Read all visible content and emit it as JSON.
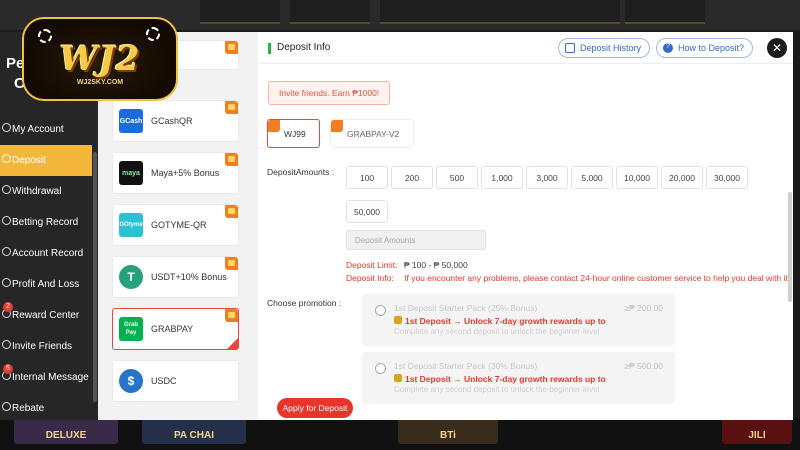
{
  "logo": {
    "text": "WJ2",
    "site": "WJ2SKY.COM"
  },
  "sidebar": {
    "title_fragment_1": "Pe",
    "title_fragment_2": "Co",
    "items": [
      {
        "label": "My Account",
        "icon": "user-icon",
        "active": false
      },
      {
        "label": "Deposit",
        "icon": "wallet-icon",
        "active": true
      },
      {
        "label": "Withdrawal",
        "icon": "withdraw-icon",
        "active": false
      },
      {
        "label": "Betting Record",
        "icon": "record-icon",
        "active": false
      },
      {
        "label": "Account Record",
        "icon": "list-icon",
        "active": false
      },
      {
        "label": "Profit And Loss",
        "icon": "chart-icon",
        "active": false
      },
      {
        "label": "Reward Center",
        "icon": "gift-icon",
        "active": false,
        "badge": "2"
      },
      {
        "label": "Invite Friends",
        "icon": "friends-icon",
        "active": false
      },
      {
        "label": "Internal Message",
        "icon": "message-icon",
        "active": false,
        "badge": "5"
      },
      {
        "label": "Rebate",
        "icon": "rebate-icon",
        "active": false
      }
    ]
  },
  "channels": [
    {
      "label": "",
      "logo_text": "",
      "logo_color": "#ffffff",
      "selected": false
    },
    {
      "label": "GCashQR",
      "logo_text": "GCash",
      "logo_color": "#1a6be0",
      "selected": false
    },
    {
      "label": "Maya+5% Bonus",
      "logo_text": "maya",
      "logo_color": "#111111",
      "selected": false
    },
    {
      "label": "GOTYME-QR",
      "logo_text": "GOtyme",
      "logo_color": "#29c2d3",
      "selected": false
    },
    {
      "label": "USDT+10% Bonus",
      "logo_text": "T",
      "logo_color": "#26a17b",
      "selected": false
    },
    {
      "label": "GRABPAY",
      "logo_text": "Grab Pay",
      "logo_color": "#00b14f",
      "selected": true
    },
    {
      "label": "USDC",
      "logo_text": "$",
      "logo_color": "#2775ca",
      "selected": false
    }
  ],
  "panel": {
    "title": "Deposit Info",
    "history_label": "Deposit History",
    "howto_label": "How to Deposit?",
    "close_glyph": "✕",
    "invite_text": "Invite friends. Earn ₱1000!",
    "sub_channels": [
      {
        "label": "WJ99",
        "selected": true
      },
      {
        "label": "GRABPAY-V2",
        "selected": false
      }
    ],
    "amounts_label": "DepositAmounts :",
    "amounts": [
      "100",
      "200",
      "500",
      "1,000",
      "3,000",
      "5,000",
      "10,000",
      "20,000",
      "30,000",
      "50,000"
    ],
    "amount_placeholder": "Deposit Amounts",
    "limit_label": "Deposit Limit:",
    "limit_value": "₱ 100 - ₱ 50,000",
    "info_label": "Deposit Info:",
    "info_text": "If you encounter any problems, please contact 24-hour online customer service to help you deal with it",
    "promotion_label": "Choose promotion :",
    "promotions": [
      {
        "title": "1st Deposit Starter Pack (25% Bonus)",
        "amount": "≥₱ 200.00",
        "desc": "1st Deposit → Unlock 7-day growth rewards up to ₱",
        "sub": "Complete any second deposit to unlock the beginner-level"
      },
      {
        "title": "1st Deposit Starter Pack (30% Bonus)",
        "amount": "≥₱ 500.00",
        "desc": "1st Deposit → Unlock 7-day growth rewards up to ₱",
        "sub": "Complete any second deposit to unlock the beginner-level"
      }
    ],
    "apply_label": "Apply for Deposit"
  },
  "games": [
    "DELUXE",
    "PA CHAI",
    "BTi",
    "JILI"
  ],
  "colors": {
    "accent": "#f3b73b",
    "danger": "#e8342b",
    "link": "#3568c9",
    "success": "#2bb24c"
  }
}
